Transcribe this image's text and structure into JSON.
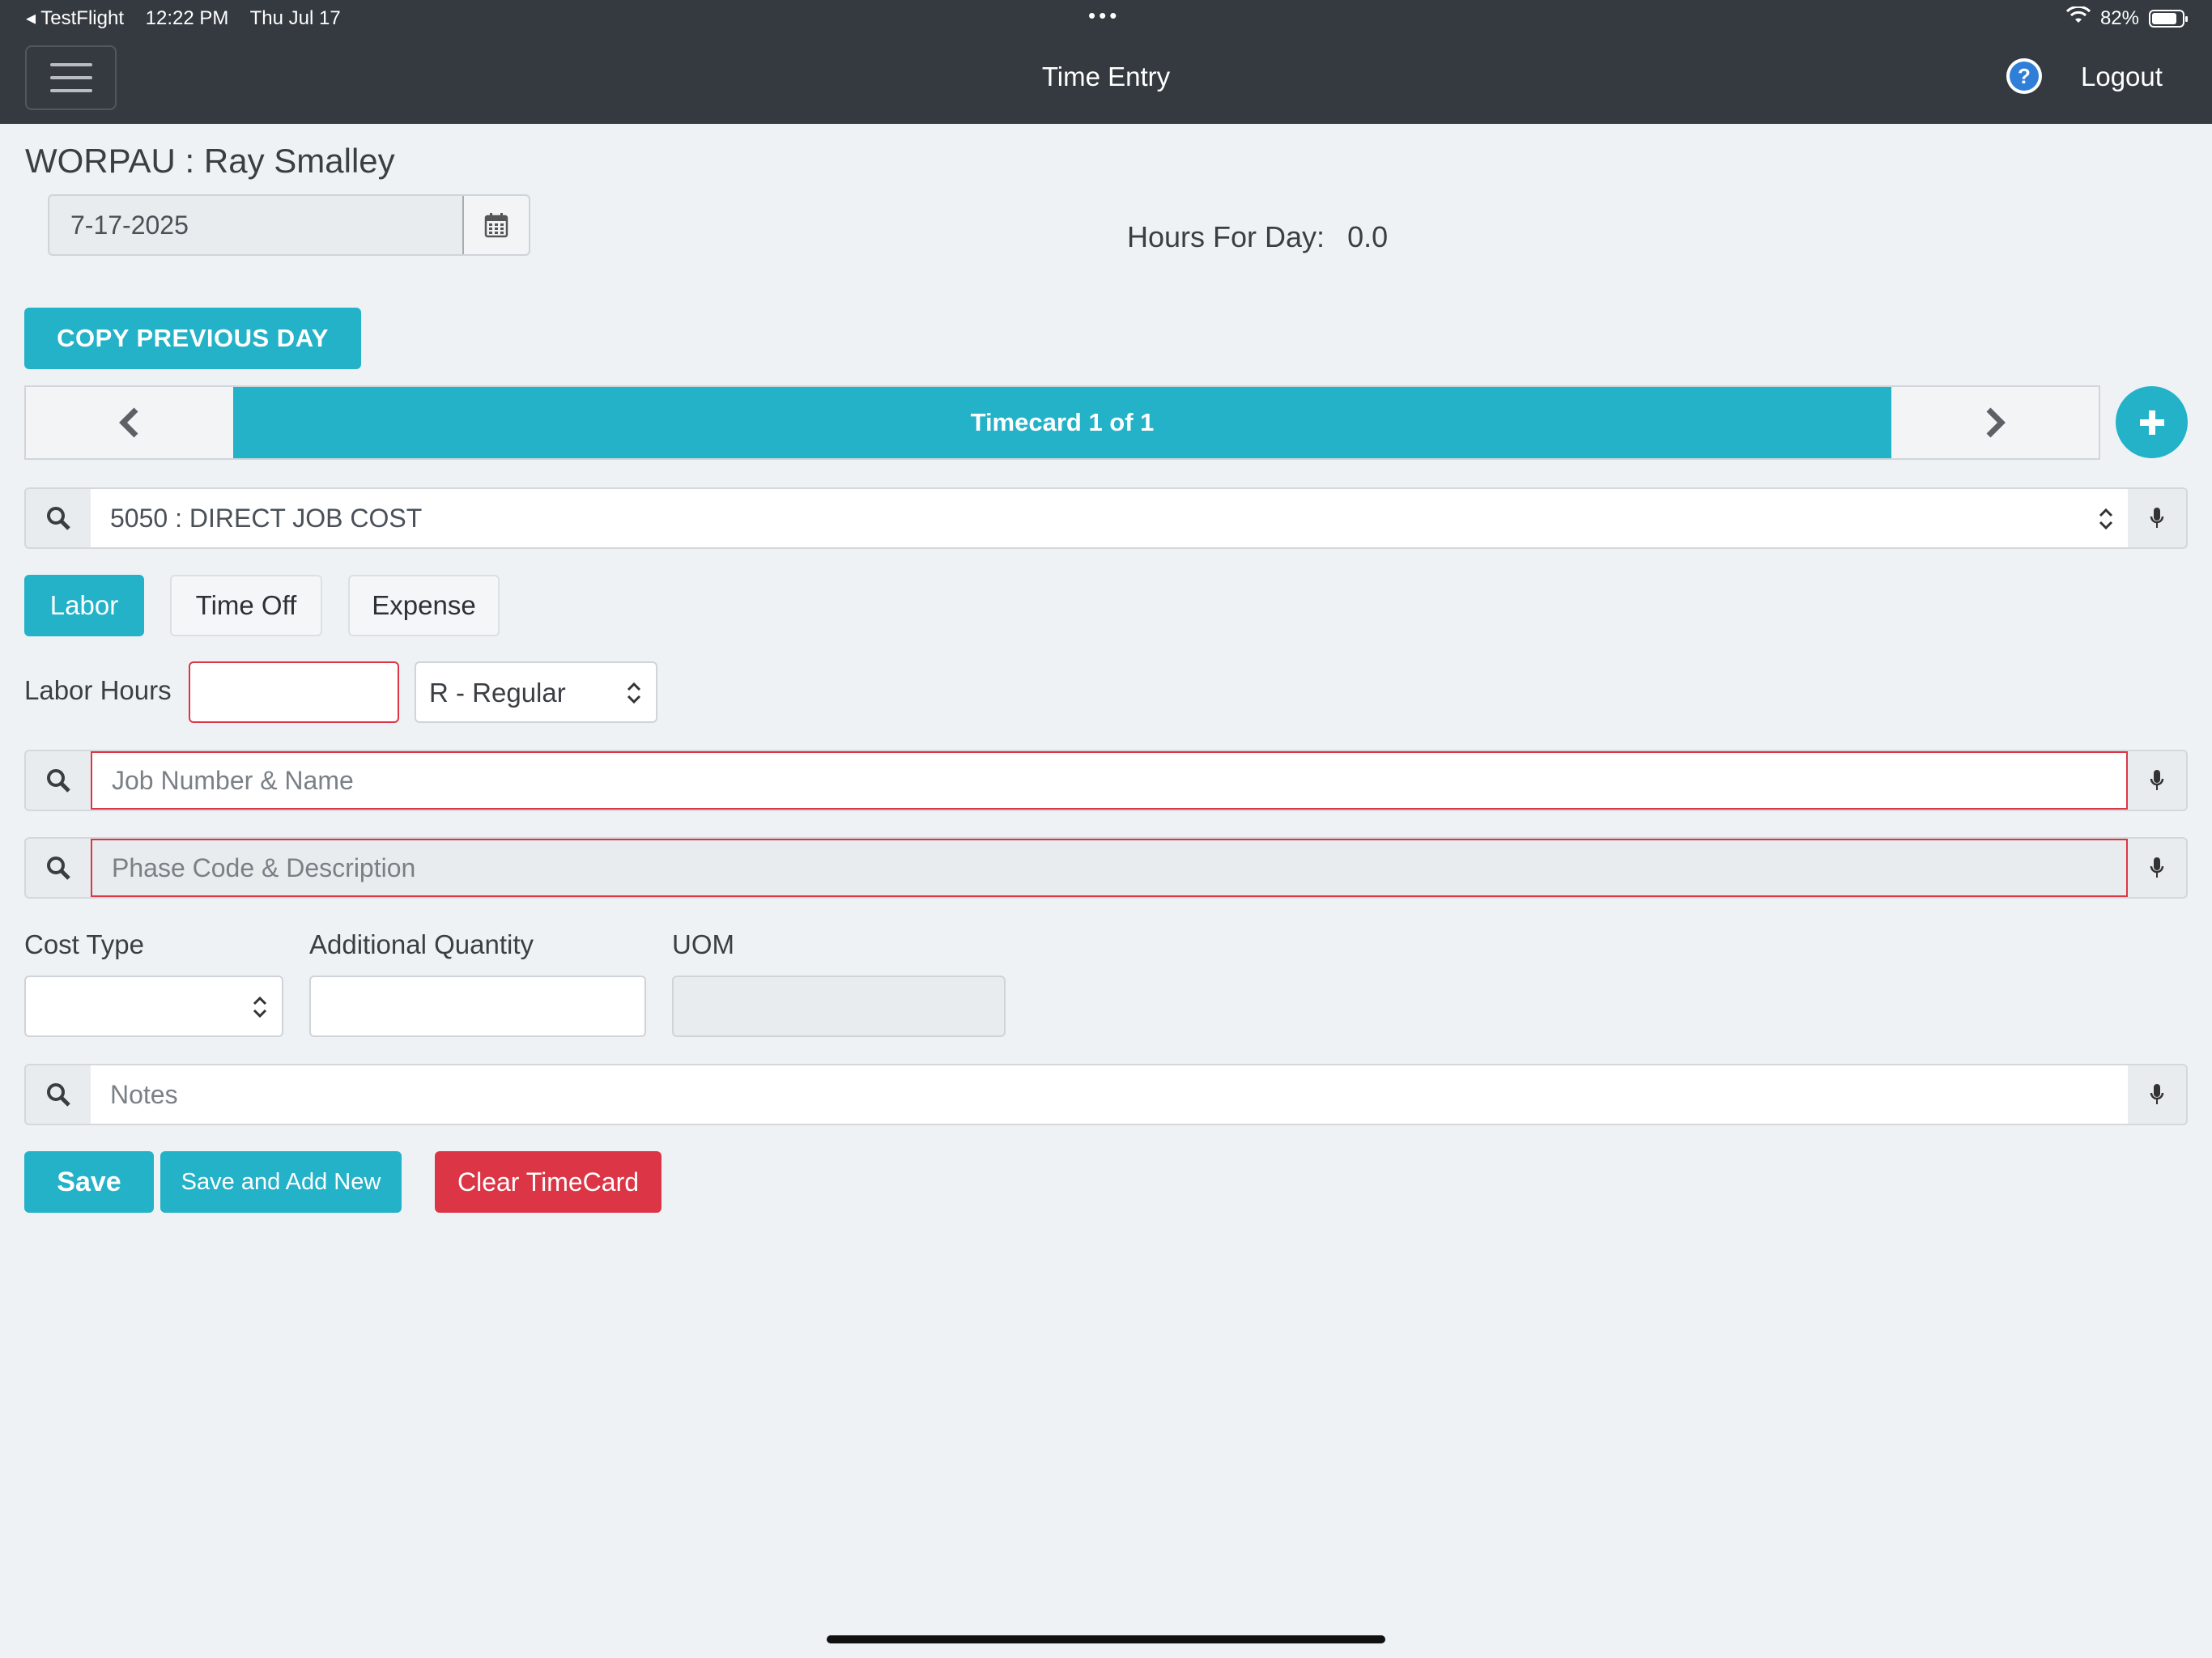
{
  "status_bar": {
    "back_app": "◂ TestFlight",
    "time": "12:22 PM",
    "date": "Thu Jul 17",
    "dots": "•••",
    "battery": "82%",
    "battery_level": 0.82
  },
  "header": {
    "title": "Time Entry",
    "help": "?",
    "logout": "Logout"
  },
  "employee": {
    "heading": "WORPAU : Ray Smalley",
    "date": "7-17-2025",
    "hours_label": "Hours For Day:",
    "hours_value": "0.0"
  },
  "actions": {
    "copy_previous": "COPY PREVIOUS DAY"
  },
  "timecard": {
    "label": "Timecard 1 of 1"
  },
  "account": {
    "value": "5050 : DIRECT JOB COST"
  },
  "tabs": [
    {
      "label": "Labor",
      "active": true
    },
    {
      "label": "Time Off",
      "active": false
    },
    {
      "label": "Expense",
      "active": false
    }
  ],
  "labor": {
    "hours_label": "Labor Hours",
    "hours_value": "",
    "pay_type": "R - Regular"
  },
  "job": {
    "placeholder": "Job Number & Name"
  },
  "phase": {
    "placeholder": "Phase Code & Description"
  },
  "cost": {
    "cost_type_label": "Cost Type",
    "additional_qty_label": "Additional Quantity",
    "uom_label": "UOM"
  },
  "notes": {
    "placeholder": "Notes"
  },
  "buttons": {
    "save": "Save",
    "save_new": "Save and Add New",
    "clear": "Clear TimeCard"
  },
  "colors": {
    "accent": "#23b2c8",
    "danger": "#dc3545",
    "topbar": "#343a40"
  }
}
